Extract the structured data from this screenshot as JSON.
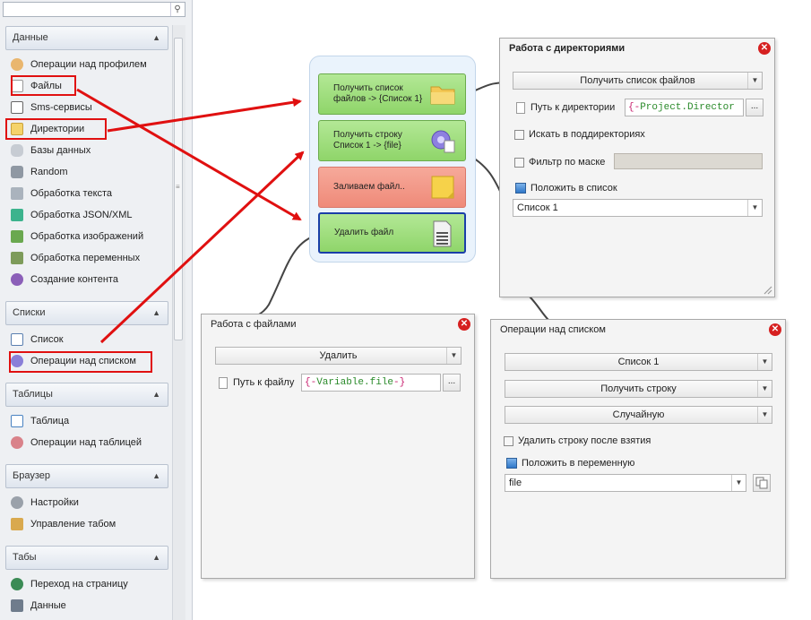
{
  "sidebar": {
    "groups": [
      {
        "label": "Данные"
      },
      {
        "label": "Списки"
      },
      {
        "label": "Таблицы"
      },
      {
        "label": "Браузер"
      },
      {
        "label": "Табы"
      }
    ],
    "items": {
      "profile_ops": "Операции над профилем",
      "files": "Файлы",
      "sms": "Sms-сервисы",
      "directories": "Директории",
      "databases": "Базы данных",
      "random": "Random",
      "text_processing": "Обработка текста",
      "json_xml": "Обработка JSON/XML",
      "images": "Обработка изображений",
      "variables": "Обработка переменных",
      "content": "Создание контента",
      "list": "Список",
      "list_ops": "Операции над списком",
      "table": "Таблица",
      "table_ops": "Операции над таблицей",
      "settings": "Настройки",
      "tab_control": "Управление табом",
      "navigate": "Переход на страницу",
      "data": "Данные"
    }
  },
  "flow": {
    "nodes": [
      {
        "label": "Получить список файлов -> {Список 1}"
      },
      {
        "label": "Получить строку Список 1 -> {file}"
      },
      {
        "label": "Заливаем файл.."
      },
      {
        "label": "Удалить файл"
      }
    ]
  },
  "panels": {
    "directories": {
      "title": "Работа с директориями",
      "action": "Получить список файлов",
      "path_label": "Путь к директории",
      "path_prefix": "{-",
      "path_name": "Project.Director",
      "browse": "...",
      "subdirs_label": "Искать в поддиректориях",
      "mask_label": "Фильтр по маске",
      "put_label": "Положить в список",
      "list_value": "Список 1"
    },
    "files": {
      "title": "Работа с файлами",
      "action": "Удалить",
      "path_label": "Путь к файлу",
      "path_open": "{-",
      "path_name": "Variable.file",
      "path_close": "-}",
      "browse": "..."
    },
    "list_ops": {
      "title": "Операции над списком",
      "list": "Список 1",
      "action": "Получить строку",
      "mode": "Случайную",
      "delete_label": "Удалить строку после взятия",
      "put_label": "Положить в переменную",
      "variable": "file"
    }
  },
  "colors": {
    "highlight": "#e01010",
    "arrow": "#e01010",
    "node_green": "#8fd56a",
    "node_red": "#ef8a79",
    "selected_border": "#1a3fa8"
  }
}
